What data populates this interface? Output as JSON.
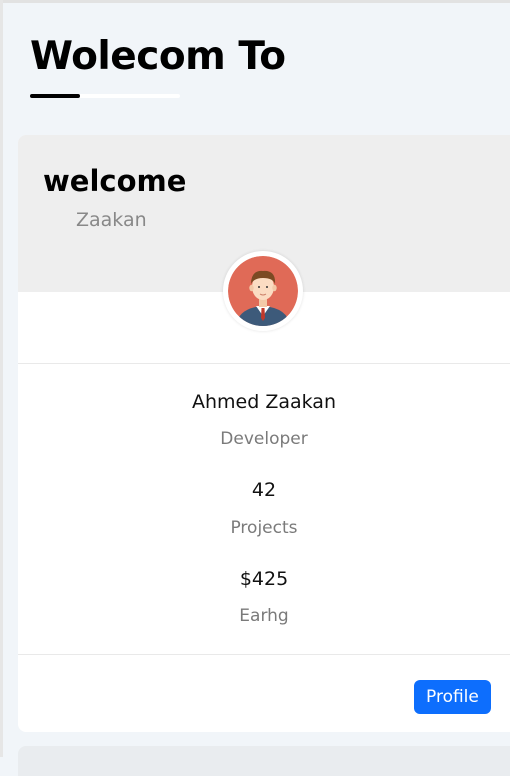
{
  "page": {
    "title": "Wolecom To"
  },
  "card": {
    "heading": "welcome",
    "subheading": "Zaakan",
    "avatar_icon": "user-avatar-icon",
    "name": "Ahmed Zaakan",
    "role": "Developer",
    "stats": [
      {
        "value": "42",
        "label": "Projects"
      },
      {
        "value": "$425",
        "label": "Earhg"
      }
    ],
    "profile_button": "Profile"
  },
  "colors": {
    "accent": "#0d6efd",
    "header_bg": "#eeeeee",
    "page_bg": "#f1f5f9"
  }
}
